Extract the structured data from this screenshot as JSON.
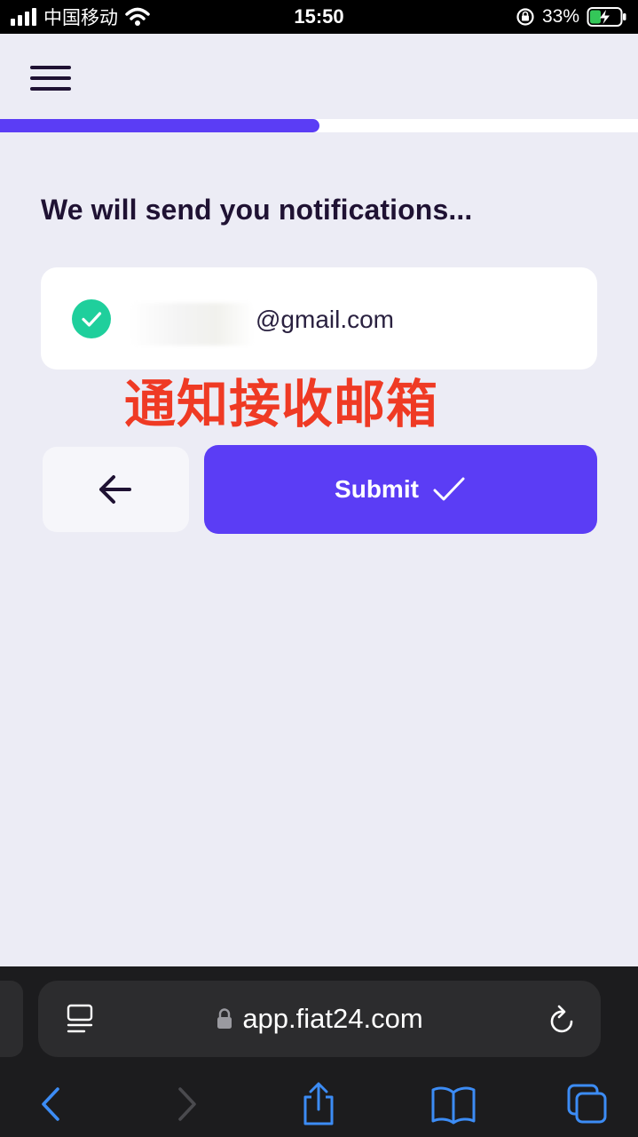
{
  "status_bar": {
    "carrier": "中国移动",
    "time": "15:50",
    "battery": "33%"
  },
  "progress": {
    "fraction": 0.5
  },
  "form": {
    "heading": "We will send you notifications...",
    "email_visible": "@gmail.com"
  },
  "annotation": "通知接收邮箱",
  "buttons": {
    "submit_label": "Submit"
  },
  "browser": {
    "url": "app.fiat24.com"
  },
  "colors": {
    "accent": "#5b3df5",
    "success": "#1fcf9c",
    "annotation": "#ef3a24",
    "ios_link": "#3c8cf5"
  },
  "icons": {
    "menu": "hamburger-icon",
    "check": "check-circle-icon",
    "back": "arrow-left-icon",
    "submit": "checkmark-icon",
    "reader": "reader-mode-icon",
    "lock": "lock-icon",
    "reload": "reload-icon",
    "nav_back": "chevron-left-icon",
    "nav_forward": "chevron-right-icon",
    "share": "share-icon",
    "bookmarks": "book-icon",
    "tabs": "tabs-icon"
  }
}
